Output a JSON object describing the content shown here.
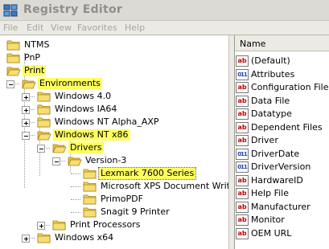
{
  "title_bar": {
    "title": "Registry Editor",
    "icon": "registry-editor-icon"
  },
  "menu": [
    "File",
    "Edit",
    "View",
    "Favorites",
    "Help"
  ],
  "tree": [
    {
      "label": "NTMS",
      "level": 0,
      "expander": "none",
      "highlighted": false
    },
    {
      "label": "PnP",
      "level": 0,
      "expander": "none",
      "highlighted": false
    },
    {
      "label": "Print",
      "level": 0,
      "expander": "expanded",
      "highlighted": true
    },
    {
      "label": "Environments",
      "level": 1,
      "expander": "expanded",
      "highlighted": true
    },
    {
      "label": "Windows 4.0",
      "level": 2,
      "expander": "collapsed",
      "highlighted": false
    },
    {
      "label": "Windows IA64",
      "level": 2,
      "expander": "collapsed",
      "highlighted": false
    },
    {
      "label": "Windows NT Alpha_AXP",
      "level": 2,
      "expander": "collapsed",
      "highlighted": false
    },
    {
      "label": "Windows NT x86",
      "level": 2,
      "expander": "expanded",
      "highlighted": true
    },
    {
      "label": "Drivers",
      "level": 3,
      "expander": "expanded",
      "highlighted": true
    },
    {
      "label": "Version-3",
      "level": 4,
      "expander": "expanded",
      "highlighted": false
    },
    {
      "label": "Lexmark 7600 Series",
      "level": 5,
      "expander": "none",
      "highlighted": true,
      "selected": true
    },
    {
      "label": "Microsoft XPS Document Write",
      "level": 5,
      "expander": "none",
      "highlighted": false
    },
    {
      "label": "PrimoPDF",
      "level": 5,
      "expander": "none",
      "highlighted": false
    },
    {
      "label": "Snagit 9 Printer",
      "level": 5,
      "expander": "none",
      "highlighted": false
    },
    {
      "label": "Print Processors",
      "level": 3,
      "expander": "collapsed",
      "highlighted": false
    },
    {
      "label": "Windows x64",
      "level": 2,
      "expander": "collapsed",
      "highlighted": false
    }
  ],
  "values": {
    "column_header": "Name",
    "rows": [
      {
        "name": "(Default)",
        "type": "string"
      },
      {
        "name": "Attributes",
        "type": "binary"
      },
      {
        "name": "Configuration File",
        "type": "string"
      },
      {
        "name": "Data File",
        "type": "string"
      },
      {
        "name": "Datatype",
        "type": "string"
      },
      {
        "name": "Dependent Files",
        "type": "string"
      },
      {
        "name": "Driver",
        "type": "string"
      },
      {
        "name": "DriverDate",
        "type": "binary"
      },
      {
        "name": "DriverVersion",
        "type": "binary"
      },
      {
        "name": "HardwareID",
        "type": "string"
      },
      {
        "name": "Help File",
        "type": "string"
      },
      {
        "name": "Manufacturer",
        "type": "string"
      },
      {
        "name": "Monitor",
        "type": "string"
      },
      {
        "name": "OEM URL",
        "type": "string"
      }
    ]
  },
  "colors": {
    "highlight": "#ffff60",
    "folder": "#f4d250",
    "string_icon": "#c00000",
    "binary_icon": "#1b3fb0"
  }
}
